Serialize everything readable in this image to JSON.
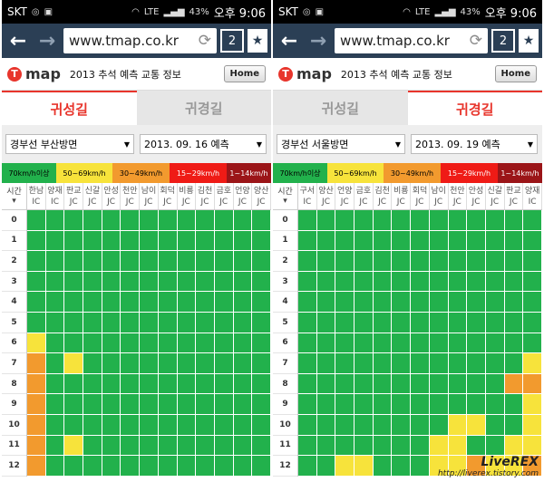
{
  "status": {
    "carrier": "SKT",
    "battery": "43%",
    "network": "LTE",
    "time": "오후 9:06"
  },
  "browser": {
    "url": "www.tmap.co.kr",
    "tab_count": "2"
  },
  "header": {
    "logo_text": "map",
    "title": "2013 추석 예측 교통 정보",
    "home_label": "Home"
  },
  "tabs": [
    "귀성길",
    "귀경길"
  ],
  "legend": [
    {
      "label": "70km/h이상",
      "color": "#22b14c"
    },
    {
      "label": "50~69km/h",
      "color": "#f7e33b"
    },
    {
      "label": "30~49km/h",
      "color": "#f29a2e"
    },
    {
      "label": "15~29km/h",
      "color": "#ef1b16"
    },
    {
      "label": "1~14km/h",
      "color": "#9b1518"
    }
  ],
  "time_header": "시간",
  "hours": [
    "0",
    "1",
    "2",
    "3",
    "4",
    "5",
    "6",
    "7",
    "8",
    "9",
    "10",
    "11",
    "12"
  ],
  "panels": [
    {
      "active_tab": 0,
      "route": "경부선 부산방면",
      "date": "2013. 09. 16 예측",
      "columns": [
        [
          "한남",
          "IC"
        ],
        [
          "양재",
          "IC"
        ],
        [
          "판교",
          "JC"
        ],
        [
          "신갈",
          "JC"
        ],
        [
          "안성",
          "JC"
        ],
        [
          "천안",
          "JC"
        ],
        [
          "남이",
          "JC"
        ],
        [
          "회덕",
          "JC"
        ],
        [
          "비룡",
          "JC"
        ],
        [
          "김천",
          "JC"
        ],
        [
          "금호",
          "JC"
        ],
        [
          "언양",
          "JC"
        ],
        [
          "양산",
          "JC"
        ]
      ],
      "grid": [
        "GGGGGGGGGGGGG",
        "GGGGGGGGGGGGG",
        "GGGGGGGGGGGGG",
        "GGGGGGGGGGGGG",
        "GGGGGGGGGGGGG",
        "GGGGGGGGGGGGG",
        "YGGGGGGGGGGGG",
        "OGYGGGGGGGGGG",
        "OGGGGGGGGGGGG",
        "OGGGGGGGGGGGG",
        "OGGGGGGGGGGGG",
        "OGYGGGGGGGGGG",
        "OGGGGGGGGGGGG"
      ]
    },
    {
      "active_tab": 1,
      "route": "경부선 서울방면",
      "date": "2013. 09. 19 예측",
      "columns": [
        [
          "구서",
          "IC"
        ],
        [
          "양산",
          "JC"
        ],
        [
          "언양",
          "JC"
        ],
        [
          "금호",
          "JC"
        ],
        [
          "김천",
          "JC"
        ],
        [
          "비룡",
          "JC"
        ],
        [
          "회덕",
          "JC"
        ],
        [
          "남이",
          "JC"
        ],
        [
          "천안",
          "JC"
        ],
        [
          "안성",
          "JC"
        ],
        [
          "신갈",
          "JC"
        ],
        [
          "판교",
          "JC"
        ],
        [
          "양재",
          "IC"
        ]
      ],
      "grid": [
        "GGGGGGGGGGGGG",
        "GGGGGGGGGGGGG",
        "GGGGGGGGGGGGG",
        "GGGGGGGGGGGGG",
        "GGGGGGGGGGGGG",
        "GGGGGGGGGGGGG",
        "GGGGGGGGGGGGG",
        "GGGGGGGGGGGGY",
        "GGGGGGGGGGGOO",
        "GGGGGGGGGGGGY",
        "GGGGGGGGYYGGY",
        "GGGGGGGYYGGYY",
        "GGYYGGGYYOYYO"
      ]
    }
  ],
  "watermark": {
    "line1": "LiveREX",
    "line2": "http://liverex.tistory.com"
  }
}
